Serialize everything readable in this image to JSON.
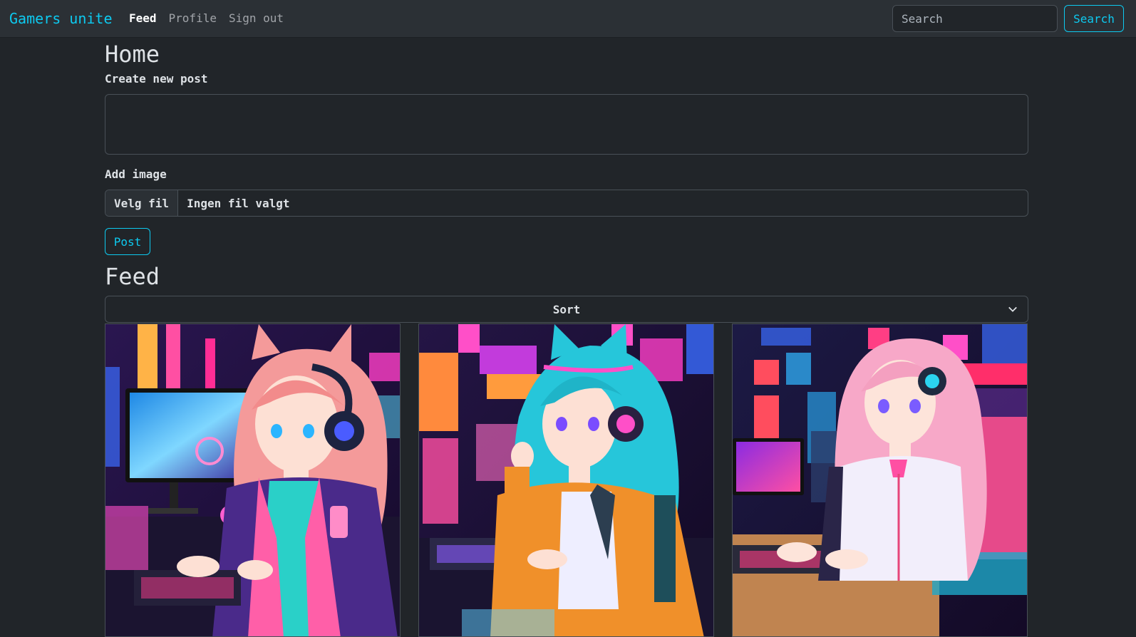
{
  "navbar": {
    "brand": "Gamers unite",
    "links": [
      {
        "label": "Feed",
        "active": true
      },
      {
        "label": "Profile",
        "active": false
      },
      {
        "label": "Sign out",
        "active": false
      }
    ],
    "search_placeholder": "Search",
    "search_button": "Search"
  },
  "home": {
    "title": "Home",
    "create_label": "Create new post",
    "textarea_value": "",
    "add_image_label": "Add image",
    "file_button": "Velg fil",
    "file_status": "Ingen fil valgt",
    "post_button": "Post"
  },
  "feed": {
    "title": "Feed",
    "sort_label": "Sort",
    "posts": [
      {
        "image": "anime-gamer-girl-pink-hair-headphones"
      },
      {
        "image": "anime-gamer-girl-teal-hair-orange-jacket"
      },
      {
        "image": "anime-gamer-girl-pink-hair-white-shirt"
      }
    ]
  },
  "colors": {
    "background": "#212529",
    "navbar": "#2b3035",
    "accent": "#0dcaf0",
    "border": "#495057"
  }
}
